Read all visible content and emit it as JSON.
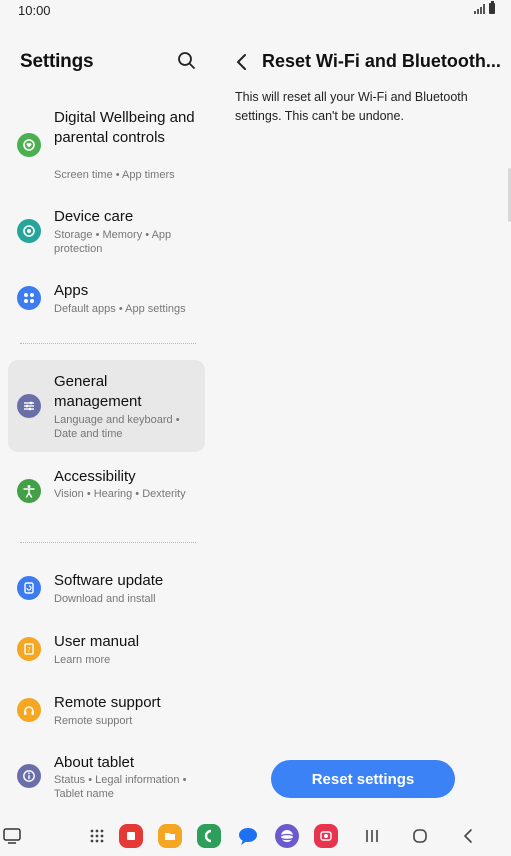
{
  "status_bar": {
    "time": "10:00"
  },
  "settings": {
    "title": "Settings",
    "items": [
      {
        "title": "Digital Wellbeing and parental controls",
        "subtitle": "Screen time  •  App timers",
        "icon": "digital-wellbeing-icon",
        "color": "#4caf50"
      },
      {
        "title": "Device care",
        "subtitle": "Storage  •  Memory  •  App protection",
        "icon": "device-care-icon",
        "color": "#26a69a"
      },
      {
        "title": "Apps",
        "subtitle": "Default apps  •  App settings",
        "icon": "apps-icon",
        "color": "#3d7bf0"
      },
      {
        "title": "General management",
        "subtitle": "Language and keyboard  •  Date and time",
        "icon": "general-management-icon",
        "color": "#6b6fa8"
      },
      {
        "title": "Accessibility",
        "subtitle": "Vision  •  Hearing  •  Dexterity",
        "icon": "accessibility-icon",
        "color": "#43a047"
      },
      {
        "title": "Software update",
        "subtitle": "Download and install",
        "icon": "software-update-icon",
        "color": "#3d7bf0"
      },
      {
        "title": "User manual",
        "subtitle": "Learn more",
        "icon": "user-manual-icon",
        "color": "#f5a623"
      },
      {
        "title": "Remote support",
        "subtitle": "Remote support",
        "icon": "remote-support-icon",
        "color": "#f5a623"
      },
      {
        "title": "About tablet",
        "subtitle": "Status  •  Legal information  •  Tablet name",
        "icon": "about-tablet-icon",
        "color": "#6b6fa8"
      }
    ]
  },
  "detail": {
    "title": "Reset Wi-Fi and Bluetooth...",
    "description": "This will reset all your Wi-Fi and Bluetooth settings. This can't be undone.",
    "button_label": "Reset settings"
  },
  "colors": {
    "accent": "#3b82f6",
    "active_item_bg": "#e8e8e8",
    "background": "#f6f6f6"
  }
}
